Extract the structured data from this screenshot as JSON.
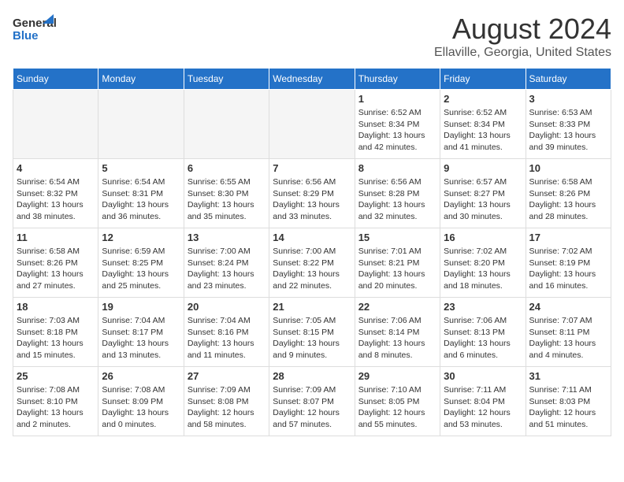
{
  "header": {
    "logo_line1": "General",
    "logo_line2": "Blue",
    "main_title": "August 2024",
    "subtitle": "Ellaville, Georgia, United States"
  },
  "calendar": {
    "weekdays": [
      "Sunday",
      "Monday",
      "Tuesday",
      "Wednesday",
      "Thursday",
      "Friday",
      "Saturday"
    ],
    "weeks": [
      [
        {
          "day": "",
          "info": ""
        },
        {
          "day": "",
          "info": ""
        },
        {
          "day": "",
          "info": ""
        },
        {
          "day": "",
          "info": ""
        },
        {
          "day": "1",
          "info": "Sunrise: 6:52 AM\nSunset: 8:34 PM\nDaylight: 13 hours\nand 42 minutes."
        },
        {
          "day": "2",
          "info": "Sunrise: 6:52 AM\nSunset: 8:34 PM\nDaylight: 13 hours\nand 41 minutes."
        },
        {
          "day": "3",
          "info": "Sunrise: 6:53 AM\nSunset: 8:33 PM\nDaylight: 13 hours\nand 39 minutes."
        }
      ],
      [
        {
          "day": "4",
          "info": "Sunrise: 6:54 AM\nSunset: 8:32 PM\nDaylight: 13 hours\nand 38 minutes."
        },
        {
          "day": "5",
          "info": "Sunrise: 6:54 AM\nSunset: 8:31 PM\nDaylight: 13 hours\nand 36 minutes."
        },
        {
          "day": "6",
          "info": "Sunrise: 6:55 AM\nSunset: 8:30 PM\nDaylight: 13 hours\nand 35 minutes."
        },
        {
          "day": "7",
          "info": "Sunrise: 6:56 AM\nSunset: 8:29 PM\nDaylight: 13 hours\nand 33 minutes."
        },
        {
          "day": "8",
          "info": "Sunrise: 6:56 AM\nSunset: 8:28 PM\nDaylight: 13 hours\nand 32 minutes."
        },
        {
          "day": "9",
          "info": "Sunrise: 6:57 AM\nSunset: 8:27 PM\nDaylight: 13 hours\nand 30 minutes."
        },
        {
          "day": "10",
          "info": "Sunrise: 6:58 AM\nSunset: 8:26 PM\nDaylight: 13 hours\nand 28 minutes."
        }
      ],
      [
        {
          "day": "11",
          "info": "Sunrise: 6:58 AM\nSunset: 8:26 PM\nDaylight: 13 hours\nand 27 minutes."
        },
        {
          "day": "12",
          "info": "Sunrise: 6:59 AM\nSunset: 8:25 PM\nDaylight: 13 hours\nand 25 minutes."
        },
        {
          "day": "13",
          "info": "Sunrise: 7:00 AM\nSunset: 8:24 PM\nDaylight: 13 hours\nand 23 minutes."
        },
        {
          "day": "14",
          "info": "Sunrise: 7:00 AM\nSunset: 8:22 PM\nDaylight: 13 hours\nand 22 minutes."
        },
        {
          "day": "15",
          "info": "Sunrise: 7:01 AM\nSunset: 8:21 PM\nDaylight: 13 hours\nand 20 minutes."
        },
        {
          "day": "16",
          "info": "Sunrise: 7:02 AM\nSunset: 8:20 PM\nDaylight: 13 hours\nand 18 minutes."
        },
        {
          "day": "17",
          "info": "Sunrise: 7:02 AM\nSunset: 8:19 PM\nDaylight: 13 hours\nand 16 minutes."
        }
      ],
      [
        {
          "day": "18",
          "info": "Sunrise: 7:03 AM\nSunset: 8:18 PM\nDaylight: 13 hours\nand 15 minutes."
        },
        {
          "day": "19",
          "info": "Sunrise: 7:04 AM\nSunset: 8:17 PM\nDaylight: 13 hours\nand 13 minutes."
        },
        {
          "day": "20",
          "info": "Sunrise: 7:04 AM\nSunset: 8:16 PM\nDaylight: 13 hours\nand 11 minutes."
        },
        {
          "day": "21",
          "info": "Sunrise: 7:05 AM\nSunset: 8:15 PM\nDaylight: 13 hours\nand 9 minutes."
        },
        {
          "day": "22",
          "info": "Sunrise: 7:06 AM\nSunset: 8:14 PM\nDaylight: 13 hours\nand 8 minutes."
        },
        {
          "day": "23",
          "info": "Sunrise: 7:06 AM\nSunset: 8:13 PM\nDaylight: 13 hours\nand 6 minutes."
        },
        {
          "day": "24",
          "info": "Sunrise: 7:07 AM\nSunset: 8:11 PM\nDaylight: 13 hours\nand 4 minutes."
        }
      ],
      [
        {
          "day": "25",
          "info": "Sunrise: 7:08 AM\nSunset: 8:10 PM\nDaylight: 13 hours\nand 2 minutes."
        },
        {
          "day": "26",
          "info": "Sunrise: 7:08 AM\nSunset: 8:09 PM\nDaylight: 13 hours\nand 0 minutes."
        },
        {
          "day": "27",
          "info": "Sunrise: 7:09 AM\nSunset: 8:08 PM\nDaylight: 12 hours\nand 58 minutes."
        },
        {
          "day": "28",
          "info": "Sunrise: 7:09 AM\nSunset: 8:07 PM\nDaylight: 12 hours\nand 57 minutes."
        },
        {
          "day": "29",
          "info": "Sunrise: 7:10 AM\nSunset: 8:05 PM\nDaylight: 12 hours\nand 55 minutes."
        },
        {
          "day": "30",
          "info": "Sunrise: 7:11 AM\nSunset: 8:04 PM\nDaylight: 12 hours\nand 53 minutes."
        },
        {
          "day": "31",
          "info": "Sunrise: 7:11 AM\nSunset: 8:03 PM\nDaylight: 12 hours\nand 51 minutes."
        }
      ]
    ]
  }
}
